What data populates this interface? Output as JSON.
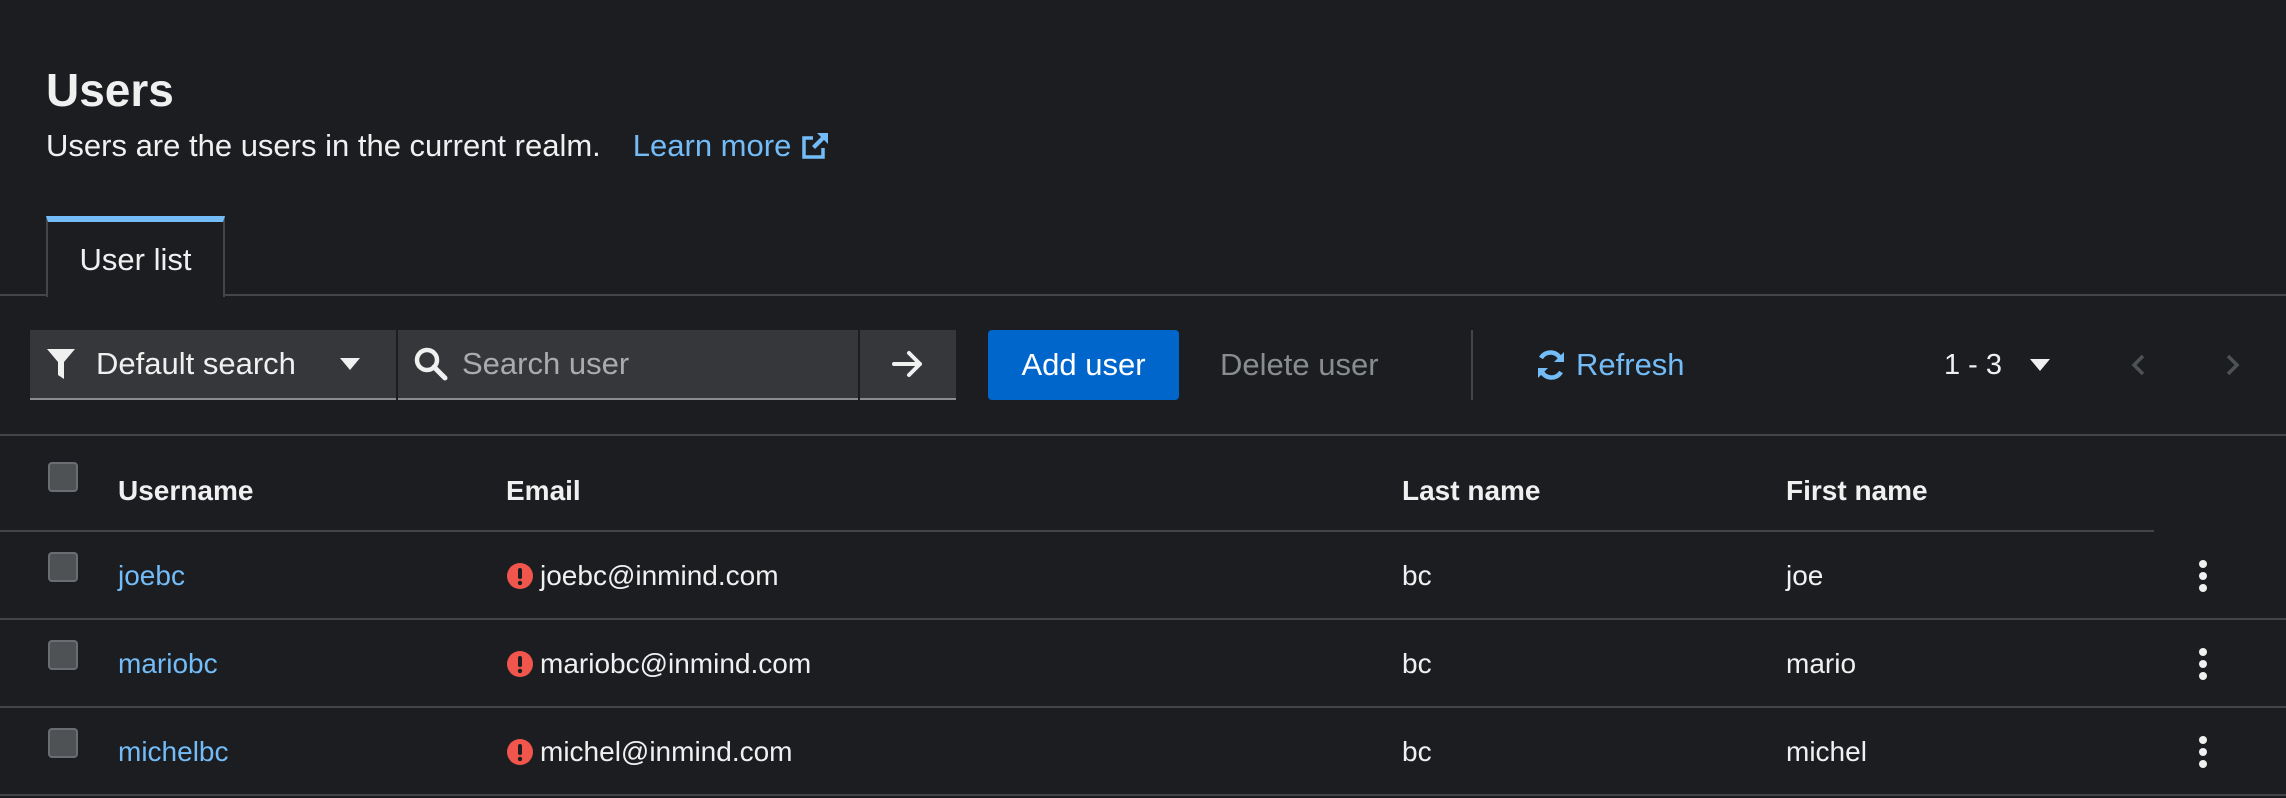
{
  "header": {
    "title": "Users",
    "subtitle": "Users are the users in the current realm.",
    "learn_more": "Learn more"
  },
  "tabs": [
    {
      "label": "User list",
      "active": true
    }
  ],
  "toolbar": {
    "filter_label": "Default search",
    "search_placeholder": "Search user",
    "add_user": "Add user",
    "delete_user": "Delete user",
    "refresh": "Refresh",
    "pagination": "1 - 3"
  },
  "table": {
    "columns": [
      "Username",
      "Email",
      "Last name",
      "First name"
    ],
    "rows": [
      {
        "username": "joebc",
        "email": "joebc@inmind.com",
        "email_warning": true,
        "last_name": "bc",
        "first_name": "joe"
      },
      {
        "username": "mariobc",
        "email": "mariobc@inmind.com",
        "email_warning": true,
        "last_name": "bc",
        "first_name": "mario"
      },
      {
        "username": "michelbc",
        "email": "michel@inmind.com",
        "email_warning": true,
        "last_name": "bc",
        "first_name": "michel"
      }
    ]
  },
  "colors": {
    "background": "#1b1d21",
    "link": "#73bcf7",
    "primary_button": "#0066cc",
    "warning_icon": "#f0564b",
    "border": "#444548"
  },
  "icons": {
    "learn_more": "external-link-icon",
    "filter": "filter-icon",
    "search": "search-icon",
    "go": "arrow-right-icon",
    "refresh": "refresh-icon",
    "warning": "exclamation-circle-icon",
    "row_actions": "kebab-icon"
  }
}
